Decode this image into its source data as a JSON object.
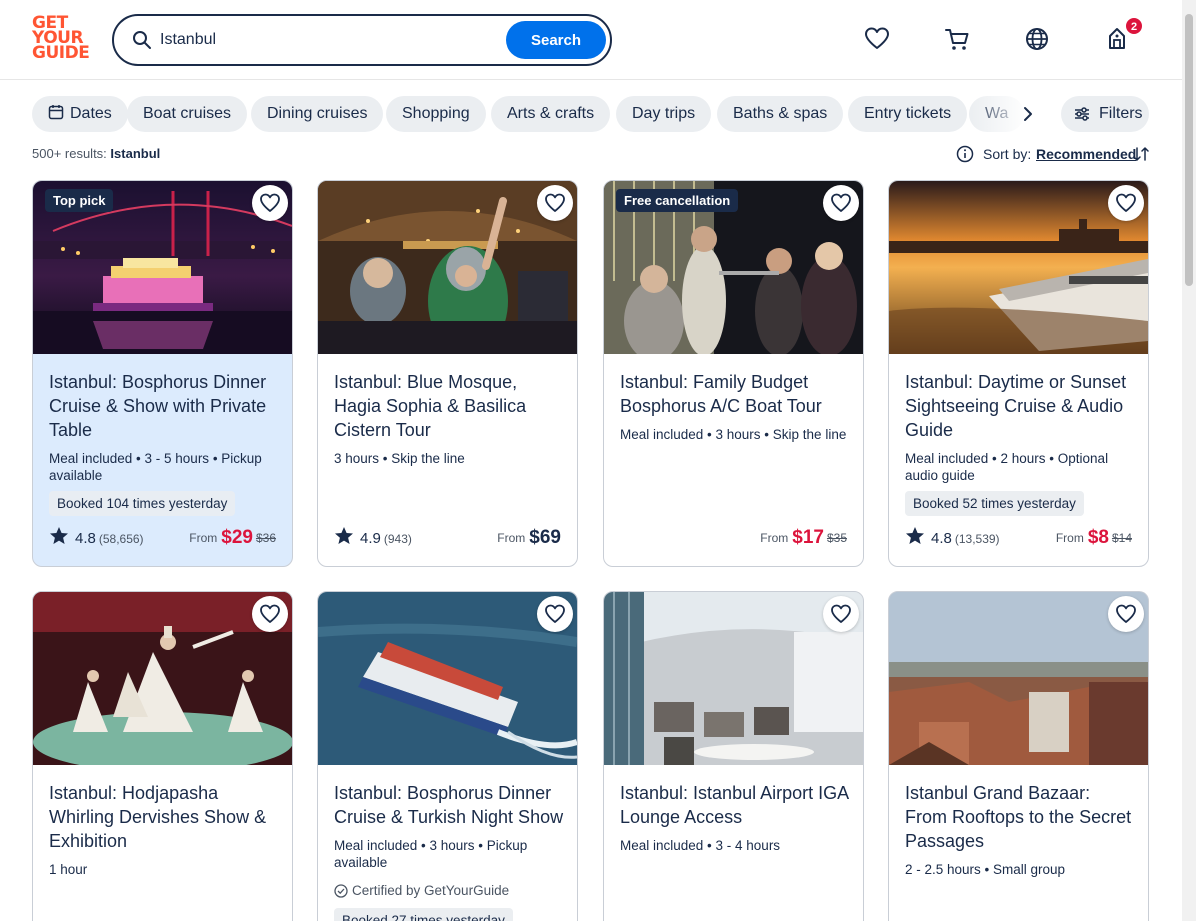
{
  "logo": {
    "line1": "GET",
    "line2": "YOUR",
    "line3": "GUIDE",
    "color": "#ff5533"
  },
  "search": {
    "value": "Istanbul",
    "button": "Search"
  },
  "header": {
    "cart_badge": "2"
  },
  "chips": [
    "Dates",
    "Boat cruises",
    "Dining cruises",
    "Shopping",
    "Arts & crafts",
    "Day trips",
    "Baths & spas",
    "Entry tickets",
    "Wa"
  ],
  "filters_label": "Filters",
  "results": {
    "count": "500+ results:",
    "query": "Istanbul"
  },
  "sort": {
    "label": "Sort by:",
    "value": "Recommended"
  },
  "cards": [
    {
      "tag": "Top pick",
      "title": "Istanbul: Bosphorus Dinner Cruise & Show with Private Table",
      "meta": "Meal included • 3 - 5 hours • Pickup available",
      "booked": "Booked 104 times yesterday",
      "rating": "4.8",
      "reviews": "(58,656)",
      "from": "From",
      "price": "$29",
      "old_price": "$36"
    },
    {
      "tag": "",
      "title": "Istanbul: Blue Mosque, Hagia Sophia & Basilica Cistern Tour",
      "meta": "3 hours • Skip the line",
      "booked": "",
      "rating": "4.9",
      "reviews": "(943)",
      "from": "From",
      "price": "$69",
      "old_price": ""
    },
    {
      "tag": "Free cancellation",
      "title": "Istanbul: Family Budget Bosphorus A/C Boat Tour",
      "meta": "Meal included • 3 hours • Skip the line",
      "booked": "",
      "rating": "",
      "reviews": "",
      "from": "From",
      "price": "$17",
      "old_price": "$35"
    },
    {
      "tag": "",
      "title": "Istanbul: Daytime or Sunset Sightseeing Cruise & Audio Guide",
      "meta": "Meal included • 2 hours • Optional audio guide",
      "booked": "Booked 52 times yesterday",
      "rating": "4.8",
      "reviews": "(13,539)",
      "from": "From",
      "price": "$8",
      "old_price": "$14"
    },
    {
      "tag": "",
      "title": "Istanbul: Hodjapasha Whirling Dervishes Show & Exhibition",
      "meta": "1 hour"
    },
    {
      "tag": "",
      "title": "Istanbul: Bosphorus Dinner Cruise & Turkish Night Show",
      "meta": "Meal included • 3 hours • Pickup available",
      "certified": "Certified by GetYourGuide",
      "booked": "Booked 27 times yesterday"
    },
    {
      "tag": "",
      "title": "Istanbul: Istanbul Airport IGA Lounge Access",
      "meta": "Meal included • 3 - 4 hours"
    },
    {
      "tag": "",
      "title": "Istanbul Grand Bazaar: From Rooftops to the Secret Passages",
      "meta": "2 - 2.5 hours • Small group"
    }
  ],
  "colors": {
    "primary": "#0071eb",
    "sale": "#dc143c",
    "navy": "#1a2b49",
    "highlight": "#dcebfd"
  }
}
